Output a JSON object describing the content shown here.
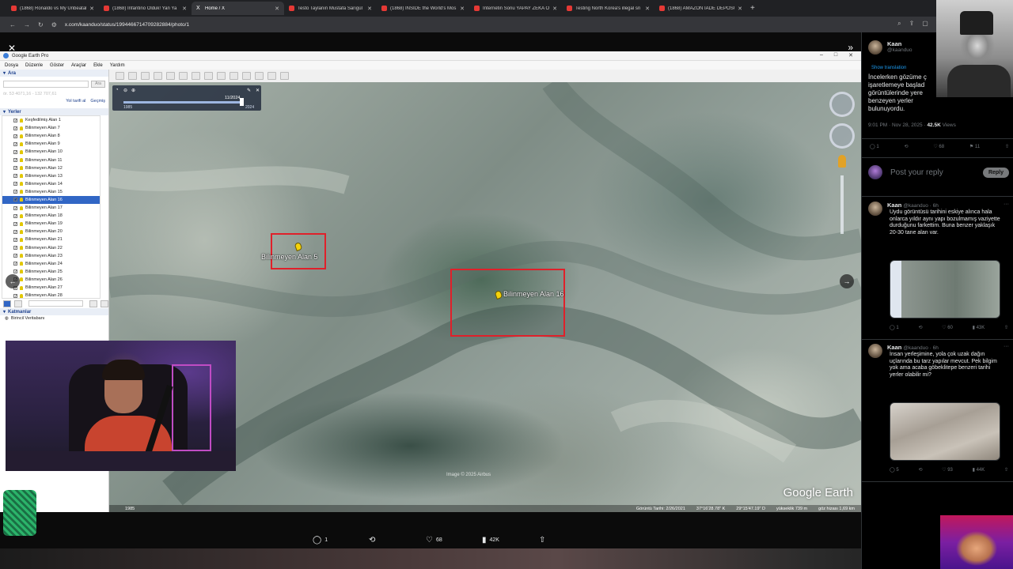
{
  "browser": {
    "tabs": [
      {
        "title": "(1868) Ronaldo vs My Unbeatab",
        "icon": "youtube-icon",
        "active": false
      },
      {
        "title": "(1868) İnfantino Olduk! Yan Ya",
        "icon": "youtube-icon",
        "active": false
      },
      {
        "title": "Home / X",
        "icon": "x-logo-icon",
        "active": true
      },
      {
        "title": "Testo Taylanın Mustafa Sarıgül",
        "icon": "youtube-icon",
        "active": false
      },
      {
        "title": "(1868) INSIDE the World's Mos",
        "icon": "youtube-icon",
        "active": false
      },
      {
        "title": "İnternetin Sonu YAPAY ZEKA Ol",
        "icon": "youtube-icon",
        "active": false
      },
      {
        "title": "Testing North Korea's illegal sn",
        "icon": "youtube-icon",
        "active": false
      },
      {
        "title": "(1868) AMAZON İADE DEPOSU",
        "icon": "youtube-icon",
        "active": false
      }
    ],
    "url": "x.com/kaanduo/status/1994466714709282884/photo/1"
  },
  "google_earth": {
    "title": "Google Earth Pro",
    "menu": [
      "Dosya",
      "Düzenle",
      "Göster",
      "Araçlar",
      "Ekle",
      "Yardım"
    ],
    "sidebar": {
      "search_header": "Ara",
      "search_hint": "ör. 53 4071,16 - 132 707,61",
      "search_button": "Ara",
      "links": [
        "Yol tarifi al",
        "Geçmiş"
      ],
      "places_header": "Yerler",
      "places": [
        "Keşfedilmiş Alan 1",
        "Bilinmeyen Alan 7",
        "Bilinmeyen Alan 8",
        "Bilinmeyen Alan 9",
        "Bilinmeyen Alan 10",
        "Bilinmeyen Alan 11",
        "Bilinmeyen Alan 12",
        "Bilinmeyen Alan 13",
        "Bilinmeyen Alan 14",
        "Bilinmeyen Alan 15",
        "Bilinmeyen Alan 16",
        "Bilinmeyen Alan 17",
        "Bilinmeyen Alan 18",
        "Bilinmeyen Alan 19",
        "Bilinmeyen Alan 20",
        "Bilinmeyen Alan 21",
        "Bilinmeyen Alan 22",
        "Bilinmeyen Alan 23",
        "Bilinmeyen Alan 24",
        "Bilinmeyen Alan 25",
        "Bilinmeyen Alan 26",
        "Bilinmeyen Alan 27",
        "Bilinmeyen Alan 28"
      ],
      "selected_place": "Bilinmeyen Alan 16",
      "layers_header": "Katmanlar",
      "layers_item": "Birincil Veritabanı"
    },
    "timebar": {
      "date": "11/2024",
      "start": "1985",
      "end": "2024"
    },
    "markers": [
      {
        "label": "Bilinmeyen Alan 5"
      },
      {
        "label": "Bilinmeyen Alan 16"
      }
    ],
    "image_credit": "Image © 2025 Airbus",
    "watermark": "Google Earth",
    "status": {
      "year": "1985",
      "imagery_date": "Görüntü Tarihi: 2/26/2021",
      "lat": "37°16'28.78\" K",
      "lon": "29°15'47.19\" D",
      "elevation": "yükseklik  739 m",
      "eye_alt": "göz hizası   1,69 km"
    }
  },
  "post_actions": {
    "replies": "1",
    "likes": "68",
    "views": "42K"
  },
  "tweet": {
    "name": "Kaan",
    "handle": "@kaanduo",
    "translate": "Show translation",
    "text": "İncelerken gözüme ç işaretlemeye başlad görüntülerinde yere benzeyen yerler bulunuyordu.",
    "time": "9:01 PM · Nov 28, 2025 ·",
    "views": "42.5K",
    "views_label": "Views",
    "likes": "68",
    "bookmarks": "11",
    "reply_placeholder": "Post your reply",
    "reply_button": "Reply"
  },
  "replies": [
    {
      "name": "Kaan",
      "meta": "@kaanduo · 6h",
      "text": "Uydu görüntüsü tarihini eskiye alınca hala onlarca yıldır aynı yapı bozulmamış vaziyette durduğunu farkettim. Buna benzer yaklaşık 20-30 tane alan var.",
      "replies": "1",
      "likes": "60",
      "views": "43K"
    },
    {
      "name": "Kaan",
      "meta": "@kaanduo · 6h",
      "text": "İnsan yerleşimine, yola çok uzak dağın uçlarında bu tarz yapılar mevcut. Pek bilgim yok ama acaba göbeklitepe benzeri tarihi yerler olabilir mi?",
      "replies": "5",
      "likes": "93",
      "views": "44K"
    }
  ]
}
